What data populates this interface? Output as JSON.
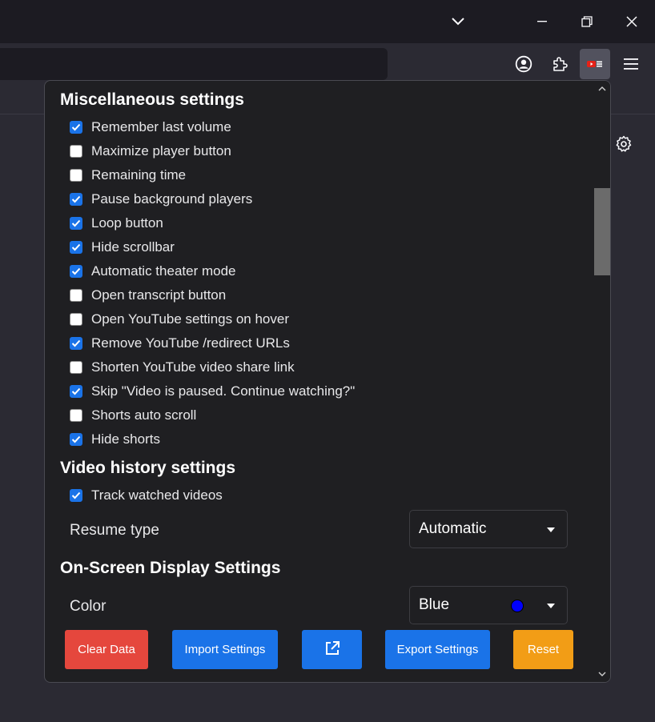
{
  "colors": {
    "accent_blue": "#1a73e8",
    "danger_red": "#e5473d",
    "warning_orange": "#f29d16",
    "popup_bg": "#1f1f22"
  },
  "browser": {
    "toolbar_icons": [
      "account-icon",
      "extensions-icon",
      "youtube-extension-icon",
      "menu-icon"
    ],
    "window_icons": [
      "chevron-down-icon",
      "minimize-icon",
      "restore-icon",
      "close-icon"
    ]
  },
  "misc": {
    "title": "Miscellaneous settings",
    "items": [
      {
        "label": "Remember last volume",
        "checked": true
      },
      {
        "label": "Maximize player button",
        "checked": false
      },
      {
        "label": "Remaining time",
        "checked": false
      },
      {
        "label": "Pause background players",
        "checked": true
      },
      {
        "label": "Loop button",
        "checked": true
      },
      {
        "label": "Hide scrollbar",
        "checked": true
      },
      {
        "label": "Automatic theater mode",
        "checked": true
      },
      {
        "label": "Open transcript button",
        "checked": false
      },
      {
        "label": "Open YouTube settings on hover",
        "checked": false
      },
      {
        "label": "Remove YouTube /redirect URLs",
        "checked": true
      },
      {
        "label": "Shorten YouTube video share link",
        "checked": false
      },
      {
        "label": "Skip \"Video is paused. Continue watching?\"",
        "checked": true
      },
      {
        "label": "Shorts auto scroll",
        "checked": false
      },
      {
        "label": "Hide shorts",
        "checked": true
      }
    ]
  },
  "history": {
    "title": "Video history settings",
    "track_label": "Track watched videos",
    "track_checked": true,
    "resume_label": "Resume type",
    "resume_value": "Automatic"
  },
  "osd": {
    "title": "On-Screen Display Settings",
    "color_label": "Color",
    "color_value": "Blue",
    "color_swatch": "#0000ff"
  },
  "footer": {
    "clear": "Clear Data",
    "import": "Import Settings",
    "export": "Export Settings",
    "reset": "Reset",
    "open_icon": "external-link-icon"
  }
}
